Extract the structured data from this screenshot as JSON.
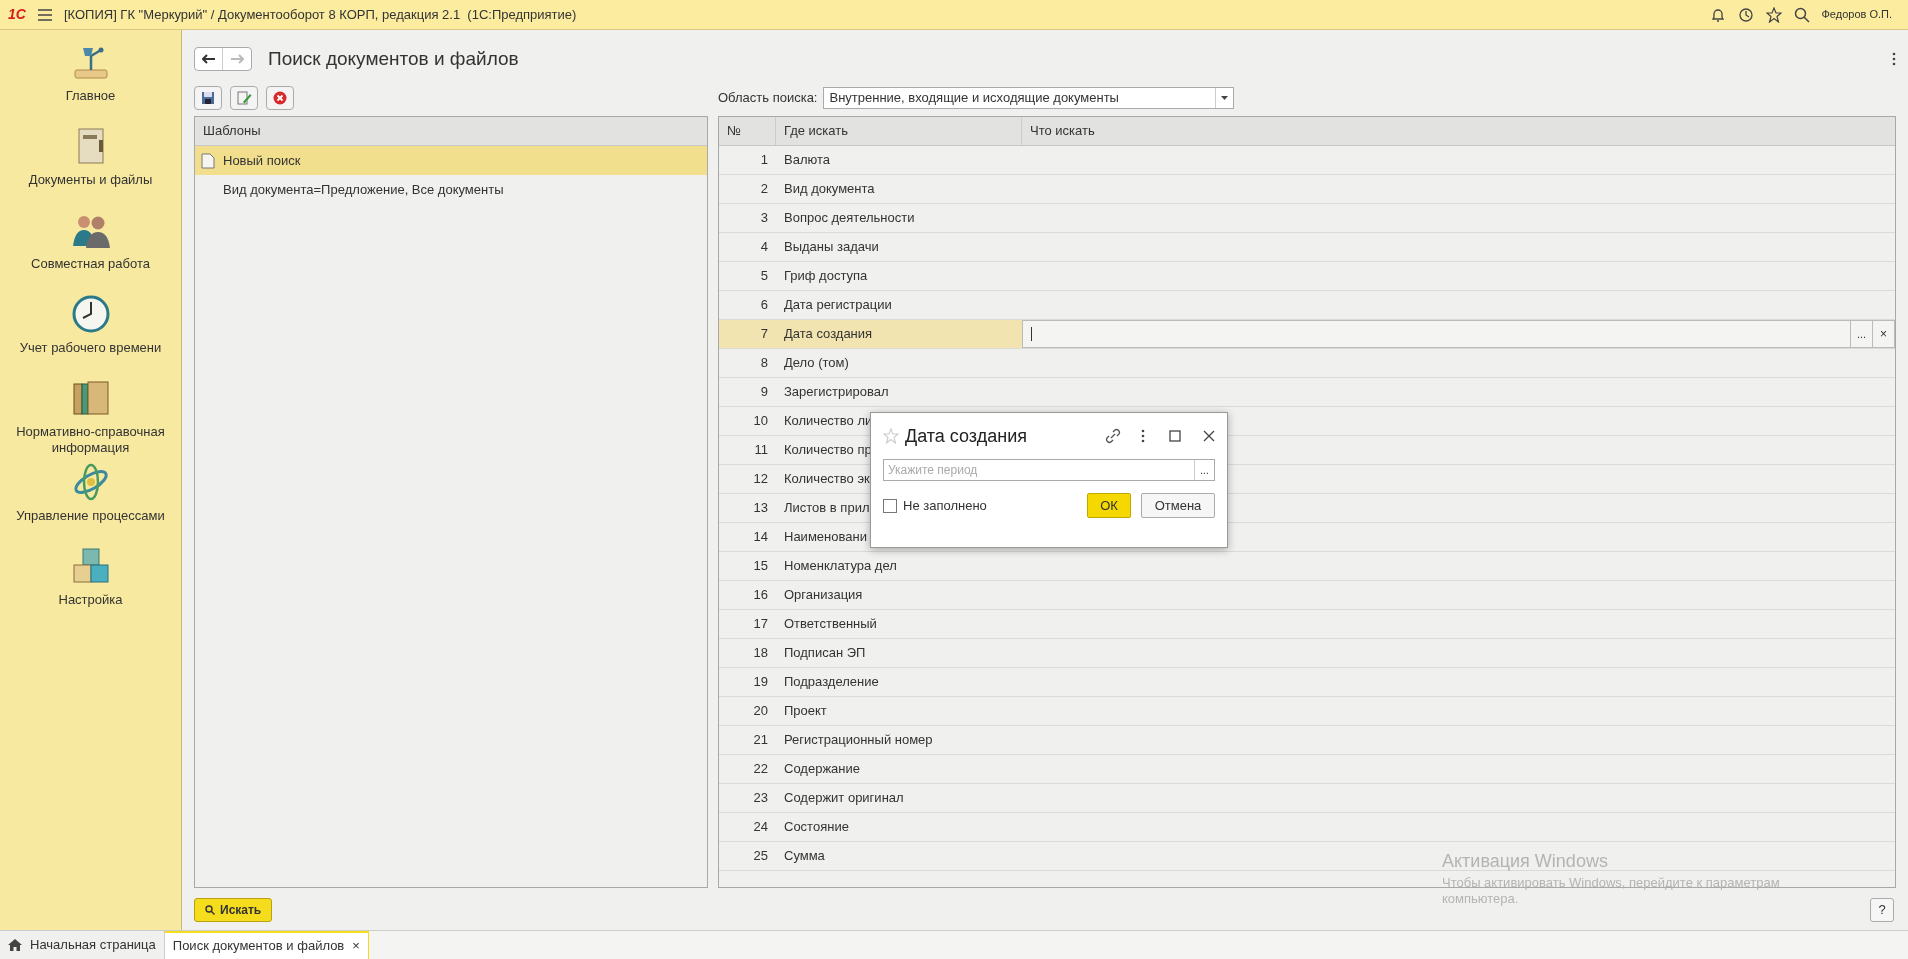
{
  "app_bar": {
    "logo": "1С",
    "title": "[КОПИЯ] ГК \"Меркурий\" / Документооборот 8 КОРП, редакция 2.1  (1С:Предприятие)",
    "user": "Федоров О.П."
  },
  "sidebar": {
    "items": [
      {
        "label": "Главное",
        "kind": "main"
      },
      {
        "label": "Документы и файлы",
        "kind": "documents"
      },
      {
        "label": "Совместная работа",
        "kind": "people"
      },
      {
        "label": "Учет рабочего времени",
        "kind": "clock"
      },
      {
        "label": "Нормативно-справочная информация",
        "kind": "folders"
      },
      {
        "label": "Управление процессами",
        "kind": "process"
      },
      {
        "label": "Настройка",
        "kind": "cubes"
      }
    ]
  },
  "form": {
    "title": "Поиск документов и файлов",
    "templates": {
      "header": "Шаблоны",
      "items": [
        {
          "label": "Новый поиск",
          "selected": true
        },
        {
          "label": "Вид документа=Предложение, Все документы",
          "selected": false
        }
      ]
    },
    "search_area": {
      "label": "Область поиска:",
      "value": "Внутренние, входящие и исходящие документы"
    },
    "table": {
      "columns": [
        "№",
        "Где искать",
        "Что искать"
      ],
      "cell_buttons": [
        "...",
        "×"
      ],
      "rows": [
        {
          "number": "1",
          "field": "Валюта",
          "selected": false
        },
        {
          "number": "2",
          "field": "Вид документа",
          "selected": false
        },
        {
          "number": "3",
          "field": "Вопрос деятельности",
          "selected": false
        },
        {
          "number": "4",
          "field": "Выданы задачи",
          "selected": false
        },
        {
          "number": "5",
          "field": "Гриф доступа",
          "selected": false
        },
        {
          "number": "6",
          "field": "Дата регистрации",
          "selected": false
        },
        {
          "number": "7",
          "field": "Дата создания",
          "selected": true
        },
        {
          "number": "8",
          "field": "Дело (том)",
          "selected": false
        },
        {
          "number": "9",
          "field": "Зарегистрировал",
          "selected": false
        },
        {
          "number": "10",
          "field": "Количество ли",
          "selected": false
        },
        {
          "number": "11",
          "field": "Количество пр",
          "selected": false
        },
        {
          "number": "12",
          "field": "Количество эк",
          "selected": false
        },
        {
          "number": "13",
          "field": "Листов в прил",
          "selected": false
        },
        {
          "number": "14",
          "field": "Наименовани",
          "selected": false
        },
        {
          "number": "15",
          "field": "Номенклатура дел",
          "selected": false
        },
        {
          "number": "16",
          "field": "Организация",
          "selected": false
        },
        {
          "number": "17",
          "field": "Ответственный",
          "selected": false
        },
        {
          "number": "18",
          "field": "Подписан ЭП",
          "selected": false
        },
        {
          "number": "19",
          "field": "Подразделение",
          "selected": false
        },
        {
          "number": "20",
          "field": "Проект",
          "selected": false
        },
        {
          "number": "21",
          "field": "Регистрационный номер",
          "selected": false
        },
        {
          "number": "22",
          "field": "Содержание",
          "selected": false
        },
        {
          "number": "23",
          "field": "Содержит оригинал",
          "selected": false
        },
        {
          "number": "24",
          "field": "Состояние",
          "selected": false
        },
        {
          "number": "25",
          "field": "Сумма",
          "selected": false
        }
      ]
    },
    "search_button": "Искать",
    "help_button": "?"
  },
  "dialog": {
    "title": "Дата создания",
    "placeholder": "Укажите период",
    "choose_button": "...",
    "checkbox": {
      "label": "Не заполнено",
      "checked": false
    },
    "ok": "ОК",
    "cancel": "Отмена"
  },
  "taskbar": {
    "tabs": [
      {
        "label": "Начальная страница",
        "kind": "home",
        "selected": false
      },
      {
        "label": "Поиск документов и файлов",
        "kind": "page",
        "selected": true,
        "close": "×"
      }
    ]
  },
  "os_notice": {
    "title": "Активация Windows",
    "text": "Чтобы активировать Windows, перейдите к параметрам компьютера."
  }
}
